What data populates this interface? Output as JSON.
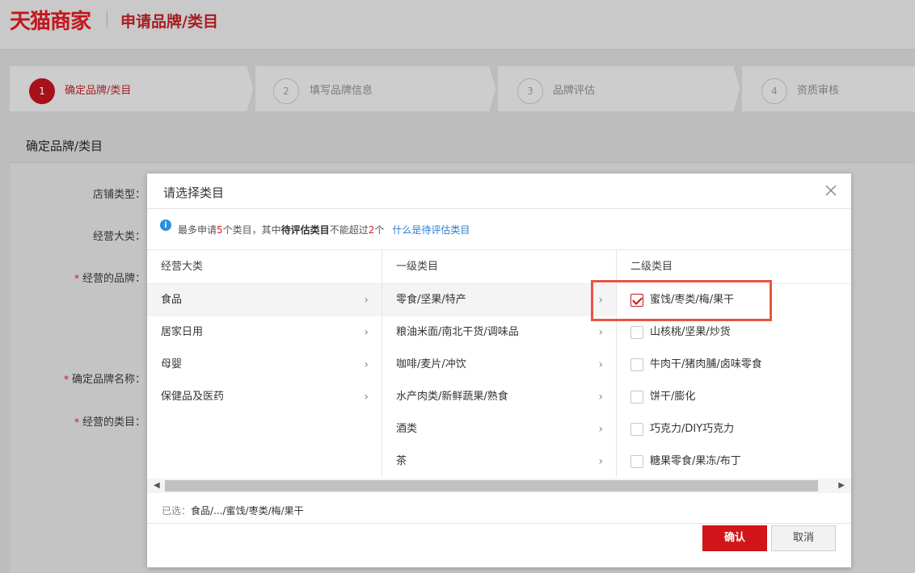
{
  "header": {
    "logo": "天猫商家",
    "title": "申请品牌/类目"
  },
  "steps": [
    {
      "num": "1",
      "label": "确定品牌/类目"
    },
    {
      "num": "2",
      "label": "填写品牌信息"
    },
    {
      "num": "3",
      "label": "品牌评估"
    },
    {
      "num": "4",
      "label": "资质审核"
    }
  ],
  "card": {
    "title": "确定品牌/类目",
    "labels": {
      "shop_type": "店铺类型：",
      "main_category": "经营大类：",
      "brand": "经营的品牌：",
      "brand_name": "确定品牌名称：",
      "category": "经营的类目："
    },
    "required_mark": "*"
  },
  "dialog": {
    "title": "请选择类目",
    "notice": {
      "pre": "最多申请",
      "max_apply": "5",
      "mid": "个类目，其中",
      "bold": "待评估类目",
      "mid2": "不能超过",
      "max_eval": "2",
      "post": "个",
      "link": "什么是待评估类目"
    },
    "columns": [
      {
        "header": "经营大类",
        "items": [
          "食品",
          "居家日用",
          "母婴",
          "保健品及医药"
        ]
      },
      {
        "header": "一级类目",
        "items": [
          "零食/坚果/特产",
          "粮油米面/南北干货/调味品",
          "咖啡/麦片/冲饮",
          "水产肉类/新鲜蔬果/熟食",
          "酒类",
          "茶"
        ]
      },
      {
        "header": "二级类目",
        "items": [
          {
            "label": "蜜饯/枣类/梅/果干",
            "checked": true
          },
          {
            "label": "山核桃/坚果/炒货",
            "checked": false
          },
          {
            "label": "牛肉干/猪肉脯/卤味零食",
            "checked": false
          },
          {
            "label": "饼干/膨化",
            "checked": false
          },
          {
            "label": "巧克力/DIY巧克力",
            "checked": false
          },
          {
            "label": "糖果零食/果冻/布丁",
            "checked": false
          }
        ]
      }
    ],
    "selected_label": "已选：",
    "selected_value": "食品/.../蜜饯/枣类/梅/果干",
    "confirm": "确认",
    "cancel": "取消"
  },
  "colors": {
    "brand": "#c4161c",
    "link": "#2a7fd4",
    "highlight": "#e8553e"
  }
}
